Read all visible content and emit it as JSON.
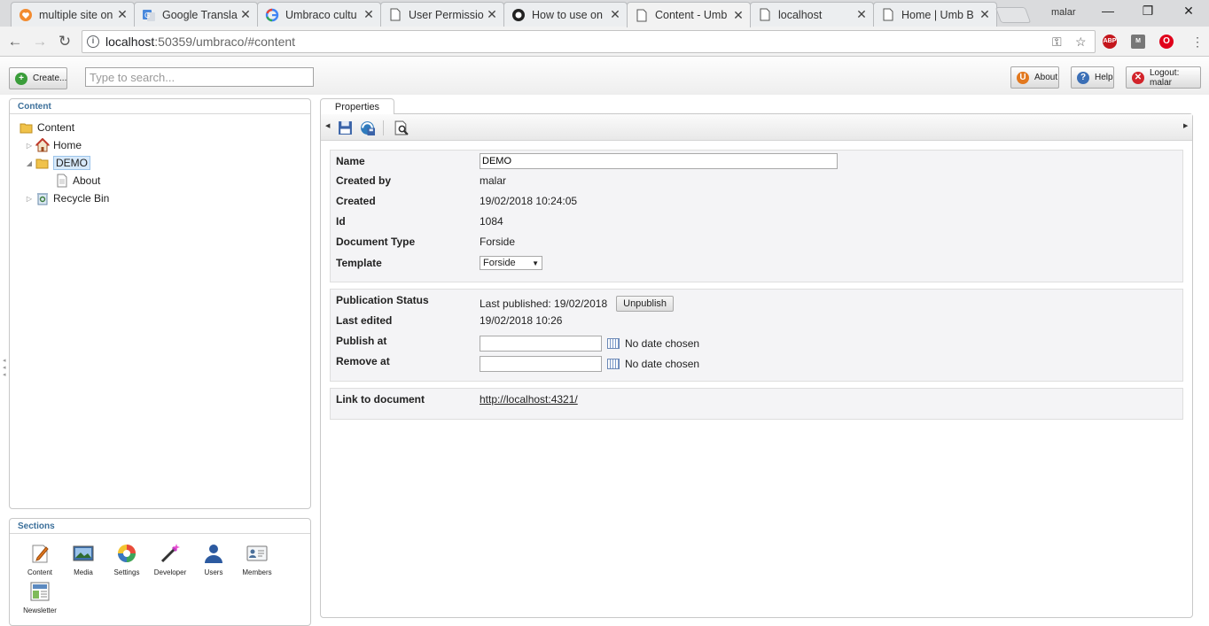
{
  "browser": {
    "tabs": [
      {
        "title": "multiple site on",
        "icon": "heart-icon"
      },
      {
        "title": "Google Transla",
        "icon": "google-translate-icon"
      },
      {
        "title": "Umbraco cultu",
        "icon": "google-icon"
      },
      {
        "title": "User Permissio",
        "icon": "page-icon"
      },
      {
        "title": "How to use on",
        "icon": "github-icon"
      },
      {
        "title": "Content - Umb",
        "icon": "page-icon",
        "active": true
      },
      {
        "title": "localhost",
        "icon": "page-icon"
      },
      {
        "title": "Home | Umb B",
        "icon": "page-icon"
      }
    ],
    "profile": "malar",
    "address": {
      "host": "localhost",
      "path": ":50359/umbraco/#content"
    },
    "extensions": {
      "abp": "ABP",
      "m": "M",
      "o": "O"
    }
  },
  "toolbar": {
    "create_label": "Create...",
    "search_placeholder": "Type to search...",
    "about_label": "About",
    "help_label": "Help",
    "logout_label": "Logout: malar"
  },
  "content_panel": {
    "header": "Content",
    "tree": {
      "root": "Content",
      "home": "Home",
      "demo": "DEMO",
      "about": "About",
      "recycle": "Recycle Bin"
    }
  },
  "sections_panel": {
    "header": "Sections",
    "items": [
      "Content",
      "Media",
      "Settings",
      "Developer",
      "Users",
      "Members",
      "Newsletter"
    ]
  },
  "editor": {
    "tab": "Properties",
    "props": {
      "name_label": "Name",
      "name_value": "DEMO",
      "createdby_label": "Created by",
      "createdby_value": "malar",
      "created_label": "Created",
      "created_value": "19/02/2018 10:24:05",
      "id_label": "Id",
      "id_value": "1084",
      "doctype_label": "Document Type",
      "doctype_value": "Forside",
      "template_label": "Template",
      "template_value": "Forside"
    },
    "publication": {
      "status_label": "Publication Status",
      "status_value": "Last published: 19/02/2018",
      "unpublish_label": "Unpublish",
      "lastedited_label": "Last edited",
      "lastedited_value": "19/02/2018 10:26",
      "publishat_label": "Publish at",
      "publishat_value": "No date chosen",
      "removeat_label": "Remove at",
      "removeat_value": "No date chosen"
    },
    "link": {
      "label": "Link to document",
      "url": "http://localhost:4321/"
    }
  }
}
